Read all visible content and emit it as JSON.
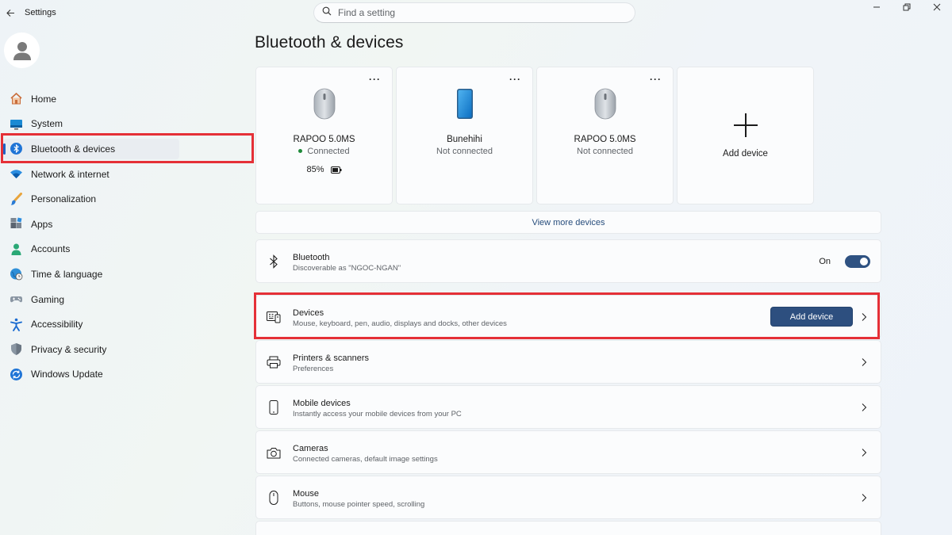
{
  "window": {
    "app_title": "Settings"
  },
  "search": {
    "placeholder": "Find a setting"
  },
  "sidebar": {
    "items": [
      {
        "label": "Home",
        "icon": "home-icon"
      },
      {
        "label": "System",
        "icon": "system-icon"
      },
      {
        "label": "Bluetooth & devices",
        "icon": "bluetooth-icon",
        "selected": true
      },
      {
        "label": "Network & internet",
        "icon": "wifi-icon"
      },
      {
        "label": "Personalization",
        "icon": "paintbrush-icon"
      },
      {
        "label": "Apps",
        "icon": "apps-icon"
      },
      {
        "label": "Accounts",
        "icon": "person-icon"
      },
      {
        "label": "Time & language",
        "icon": "globe-clock-icon"
      },
      {
        "label": "Gaming",
        "icon": "gamepad-icon"
      },
      {
        "label": "Accessibility",
        "icon": "accessibility-icon"
      },
      {
        "label": "Privacy & security",
        "icon": "shield-icon"
      },
      {
        "label": "Windows Update",
        "icon": "update-icon"
      }
    ]
  },
  "main": {
    "title": "Bluetooth & devices",
    "device_cards": [
      {
        "name": "RAPOO 5.0MS",
        "status": "Connected",
        "battery": "85%",
        "icon": "mouse-icon"
      },
      {
        "name": "Bunehihi",
        "status": "Not connected",
        "icon": "phone-icon"
      },
      {
        "name": "RAPOO 5.0MS",
        "status": "Not connected",
        "icon": "mouse-icon"
      }
    ],
    "add_device_card_label": "Add device",
    "view_more": "View more devices",
    "bluetooth_row": {
      "title": "Bluetooth",
      "subtitle": "Discoverable as \"NGOC-NGAN\"",
      "toggle_label": "On"
    },
    "devices_row": {
      "title": "Devices",
      "subtitle": "Mouse, keyboard, pen, audio, displays and docks, other devices",
      "button": "Add device"
    },
    "printers_row": {
      "title": "Printers & scanners",
      "subtitle": "Preferences"
    },
    "mobile_row": {
      "title": "Mobile devices",
      "subtitle": "Instantly access your mobile devices from your PC"
    },
    "cameras_row": {
      "title": "Cameras",
      "subtitle": "Connected cameras, default image settings"
    },
    "mouse_row": {
      "title": "Mouse",
      "subtitle": "Buttons, mouse pointer speed, scrolling"
    }
  },
  "colors": {
    "accent": "#2d4f7f",
    "highlight_box": "#e53037",
    "connected_dot": "#1f8a3a"
  }
}
